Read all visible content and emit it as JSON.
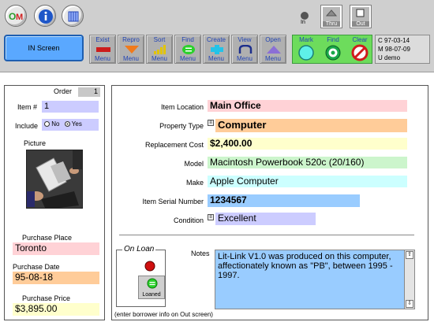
{
  "toolbar": {
    "round_buttons": [
      {
        "name": "om-logo-icon",
        "label": "OM"
      },
      {
        "name": "info-icon",
        "label": "i"
      },
      {
        "name": "columns-icon",
        "label": ""
      }
    ],
    "in_label": "In",
    "thru_label": "Thru",
    "out_label": "Out",
    "in_screen_label": "IN Screen",
    "menus": [
      {
        "top": "Exist",
        "bottom": "Menu",
        "icon": "minus-icon"
      },
      {
        "top": "Repro",
        "bottom": "Menu",
        "icon": "triangle-down-icon"
      },
      {
        "top": "Sort",
        "bottom": "Menu",
        "icon": "bars-icon"
      },
      {
        "top": "Find",
        "bottom": "Menu",
        "icon": "equals-icon"
      },
      {
        "top": "Create",
        "bottom": "Menu",
        "icon": "plus-icon"
      },
      {
        "top": "View",
        "bottom": "Menu",
        "icon": "loop-icon"
      },
      {
        "top": "Open",
        "bottom": "Menu",
        "icon": "triangle-up-icon"
      }
    ],
    "actions": [
      {
        "label": "Mark",
        "icon": "mark-icon"
      },
      {
        "label": "Find",
        "icon": "find-target-icon"
      },
      {
        "label": "Clear",
        "icon": "clear-prohibited-icon"
      }
    ],
    "info": {
      "c": "C  97-03-14",
      "m": "M  98-07-09",
      "u": "U  demo"
    }
  },
  "left": {
    "order_label": "Order",
    "order_value": "1",
    "item_label": "Item #",
    "item_value": "1",
    "include_label": "Include",
    "include_no": "No",
    "include_yes": "Yes",
    "picture_label": "Picture",
    "purchase_place_label": "Purchase Place",
    "purchase_place_value": "Toronto",
    "purchase_date_label": "Purchase Date",
    "purchase_date_value": "95-08-18",
    "purchase_price_label": "Purchase Price",
    "purchase_price_value": "$3,895.00"
  },
  "main": {
    "item_location_label": "Item Location",
    "item_location_value": "Main Office",
    "property_type_label": "Property Type",
    "property_type_value": "Computer",
    "replacement_cost_label": "Replacement Cost",
    "replacement_cost_value": "$2,400.00",
    "model_label": "Model",
    "model_value": "Macintosh Powerbook 520c (20/160)",
    "make_label": "Make",
    "make_value": "Apple Computer",
    "serial_label": "Item Serial Number",
    "serial_value": "1234567",
    "condition_label": "Condition",
    "condition_value": "Excellent",
    "on_loan_label": "On Loan",
    "loaned_label": "Loaned",
    "notes_label": "Notes",
    "notes_value": "Lit-Link V1.0 was produced on this computer, affectionately known as \"PB\", between 1995 - 1997.",
    "footer_note": "(enter borrower info on Out screen)"
  },
  "colors": {
    "pink": "#ffd2d6",
    "orange": "#ffcc99",
    "yellow": "#ffffcc",
    "green": "#ccf5cc",
    "cyan": "#ccffff",
    "blue": "#99ccff",
    "lavender": "#ccccff",
    "in_screen": "#5aa8ff",
    "action_panel": "#6ddc5c"
  }
}
